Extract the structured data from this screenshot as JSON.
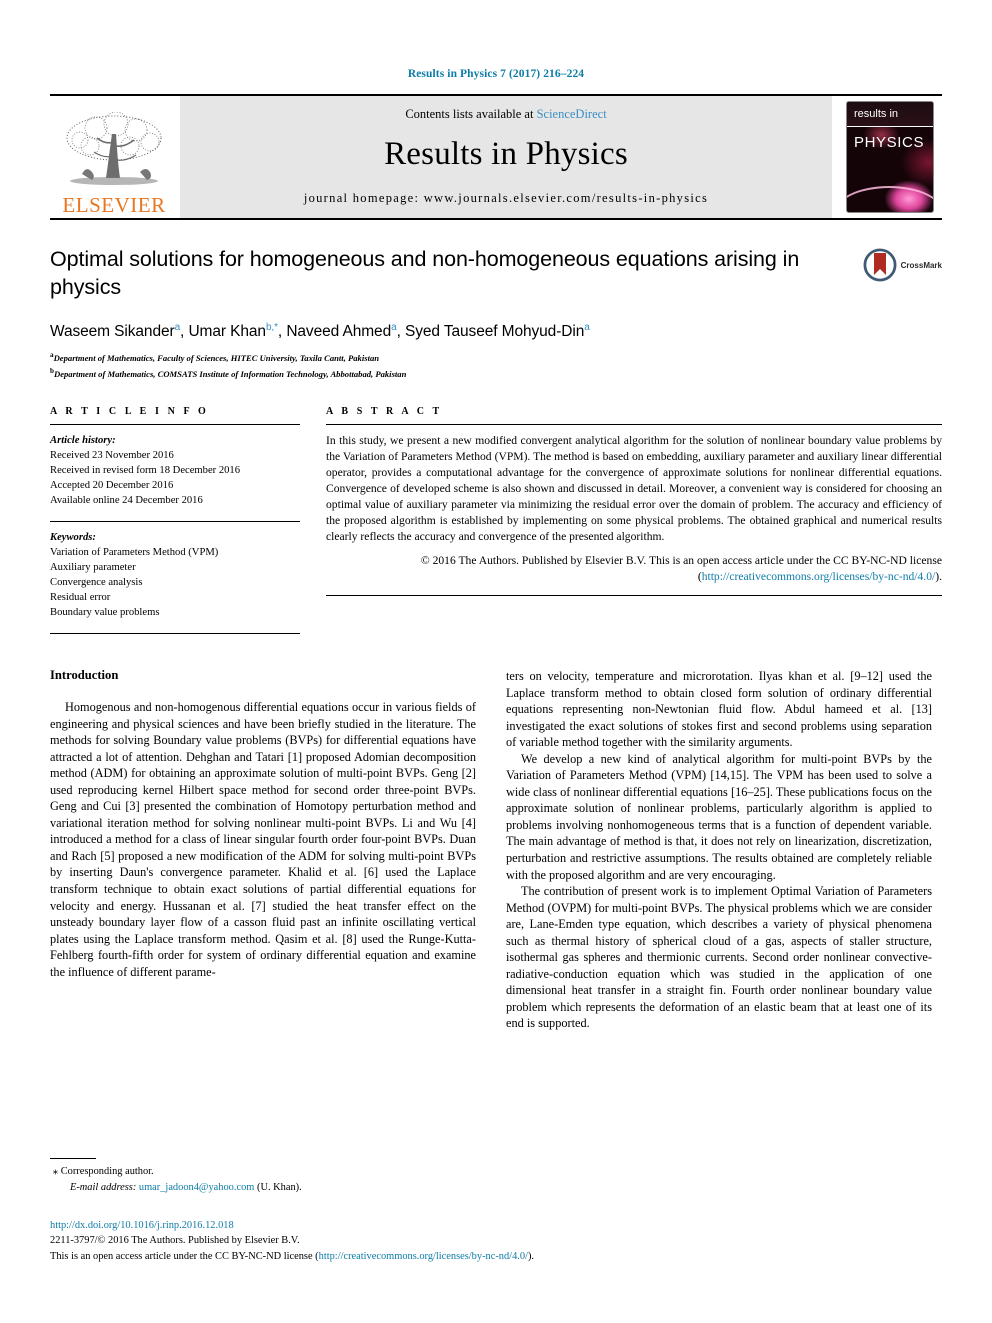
{
  "running_head": "Results in Physics 7 (2017) 216–224",
  "banner": {
    "publisher_logo_name": "ELSEVIER",
    "contents_prefix": "Contents lists available at ",
    "contents_link": "ScienceDirect",
    "journal_title": "Results in Physics",
    "homepage": "journal homepage: www.journals.elsevier.com/results-in-physics",
    "cover": {
      "top_label": "results in",
      "main_label": "PHYSICS"
    }
  },
  "article": {
    "title": "Optimal solutions for homogeneous and non-homogeneous equations arising in physics",
    "authors_html": "Waseem Sikander <sup>a</sup>, Umar Khan <sup>b,*</sup>, Naveed Ahmed <sup>a</sup>, Syed Tauseef Mohyud-Din <sup>a</sup>",
    "affiliations": [
      "Department of Mathematics, Faculty of Sciences, HITEC University, Taxila Cantt, Pakistan",
      "Department of Mathematics, COMSATS Institute of Information Technology, Abbottabad, Pakistan"
    ],
    "affiliation_marks": [
      "a",
      "b"
    ],
    "crossmark_label": "CrossMark"
  },
  "article_info": {
    "heading": "A R T I C L E    I N F O",
    "history_label": "Article history:",
    "history": [
      "Received 23 November 2016",
      "Received in revised form 18 December 2016",
      "Accepted 20 December 2016",
      "Available online 24 December 2016"
    ],
    "keywords_label": "Keywords:",
    "keywords": [
      "Variation of Parameters Method (VPM)",
      "Auxiliary parameter",
      "Convergence analysis",
      "Residual error",
      "Boundary value problems"
    ]
  },
  "abstract": {
    "heading": "A B S T R A C T",
    "text": "In this study, we present a new modified convergent analytical algorithm for the solution of nonlinear boundary value problems by the Variation of Parameters Method (VPM). The method is based on embedding, auxiliary parameter and auxiliary linear differential operator, provides a computational advantage for the convergence of approximate solutions for nonlinear differential equations. Convergence of developed scheme is also shown and discussed in detail. Moreover, a convenient way is considered for choosing an optimal value of auxiliary parameter via minimizing the residual error over the domain of problem. The accuracy and efficiency of the proposed algorithm is established by implementing on some physical problems. The obtained graphical and numerical results clearly reflects the accuracy and convergence of the presented algorithm.",
    "copyright_lead": "© 2016 The Authors. Published by Elsevier B.V. This is an open access article under the CC BY-NC-ND license (",
    "copyright_link": "http://creativecommons.org/licenses/by-nc-nd/4.0/",
    "copyright_tail": ")."
  },
  "body": {
    "section_title": "Introduction",
    "left_paragraphs": [
      "Homogenous and non-homogenous differential equations occur in various fields of engineering and physical sciences and have been briefly studied in the literature. The methods for solving Boundary value problems (BVPs) for differential equations have attracted a lot of attention. Dehghan and Tatari [1] proposed Adomian decomposition method (ADM) for obtaining an approximate solution of multi-point BVPs. Geng [2] used reproducing kernel Hilbert space method for second order three-point BVPs. Geng and Cui [3] presented the combination of Homotopy perturbation method and variational iteration method for solving nonlinear multi-point BVPs. Li and Wu [4] introduced a method for a class of linear singular fourth order four-point BVPs. Duan and Rach [5] proposed a new modification of the ADM for solving multi-point BVPs by inserting Daun's convergence parameter. Khalid et al. [6] used the Laplace transform technique to obtain exact solutions of partial differential equations for velocity and energy. Hussanan et al. [7] studied the heat transfer effect on the unsteady boundary layer flow of a casson fluid past an infinite oscillating vertical plates using the Laplace transform method. Qasim et al. [8] used the Runge-Kutta-Fehlberg fourth-fifth order for system of ordinary differential equation and examine the influence of different parame-"
    ],
    "right_paragraphs": [
      "ters on velocity, temperature and microrotation. Ilyas khan et al. [9–12] used the Laplace transform method to obtain closed form solution of ordinary differential equations representing non-Newtonian fluid flow. Abdul hameed et al. [13] investigated the exact solutions of stokes first and second problems using separation of variable method together with the similarity arguments.",
      "We develop a new kind of analytical algorithm for multi-point BVPs by the Variation of Parameters Method (VPM) [14,15]. The VPM has been used to solve a wide class of nonlinear differential equations [16–25]. These publications focus on the approximate solution of nonlinear problems, particularly algorithm is applied to problems involving nonhomogeneous terms that is a function of dependent variable. The main advantage of method is that, it does not rely on linearization, discretization, perturbation and restrictive assumptions. The results obtained are completely reliable with the proposed algorithm and are very encouraging.",
      "The contribution of present work is to implement Optimal Variation of Parameters Method (OVPM) for multi-point BVPs. The physical problems which we are consider are, Lane-Emden type equation, which describes a variety of physical phenomena such as thermal history of spherical cloud of a gas, aspects of staller structure, isothermal gas spheres and thermionic currents. Second order nonlinear convective- radiative-conduction equation which was studied in the application of one dimensional heat transfer in a straight fin. Fourth order nonlinear boundary value problem which represents the deformation of an elastic beam that at least one of its end is supported."
    ]
  },
  "footnote": {
    "star": "⁎",
    "corresponding": "Corresponding author.",
    "email_label": "E-mail address:",
    "email": "umar_jadoon4@yahoo.com",
    "email_owner": "(U. Khan)."
  },
  "page_footer": {
    "doi": "http://dx.doi.org/10.1016/j.rinp.2016.12.018",
    "issn_line": "2211-3797/© 2016 The Authors. Published by Elsevier B.V.",
    "license_lead": "This is an open access article under the CC BY-NC-ND license (",
    "license_link": "http://creativecommons.org/licenses/by-nc-nd/4.0/",
    "license_tail": ")."
  },
  "colors": {
    "link": "#0e7ca8",
    "sciencedirect": "#3a8fc4",
    "elsevier_orange": "#E87722",
    "banner_grey": "#e6e6e6"
  }
}
